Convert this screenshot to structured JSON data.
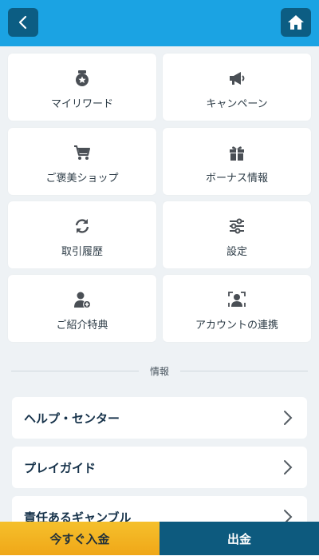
{
  "header": {
    "back_icon": "chevron-left-icon",
    "home_icon": "home-icon",
    "bar_color": "#1ba3e3",
    "button_color": "#0c5d83"
  },
  "menu": {
    "items": [
      {
        "label": "マイリワード",
        "icon": "medal-icon"
      },
      {
        "label": "キャンペーン",
        "icon": "megaphone-icon"
      },
      {
        "label": "ご褒美ショップ",
        "icon": "cart-icon"
      },
      {
        "label": "ボーナス情報",
        "icon": "gift-icon"
      },
      {
        "label": "取引履歴",
        "icon": "refresh-icon"
      },
      {
        "label": "設定",
        "icon": "sliders-icon"
      },
      {
        "label": "ご紹介特典",
        "icon": "user-plus-icon"
      },
      {
        "label": "アカウントの連携",
        "icon": "account-link-icon"
      }
    ]
  },
  "info": {
    "section_title": "情報",
    "rows": [
      {
        "label": "ヘルプ・センター"
      },
      {
        "label": "プレイガイド"
      },
      {
        "label": "責任あるギャンブル"
      }
    ]
  },
  "actions": {
    "deposit_label": "今すぐ入金",
    "withdraw_label": "出金",
    "deposit_color": "#f3b322",
    "withdraw_color": "#0d5a7e"
  }
}
